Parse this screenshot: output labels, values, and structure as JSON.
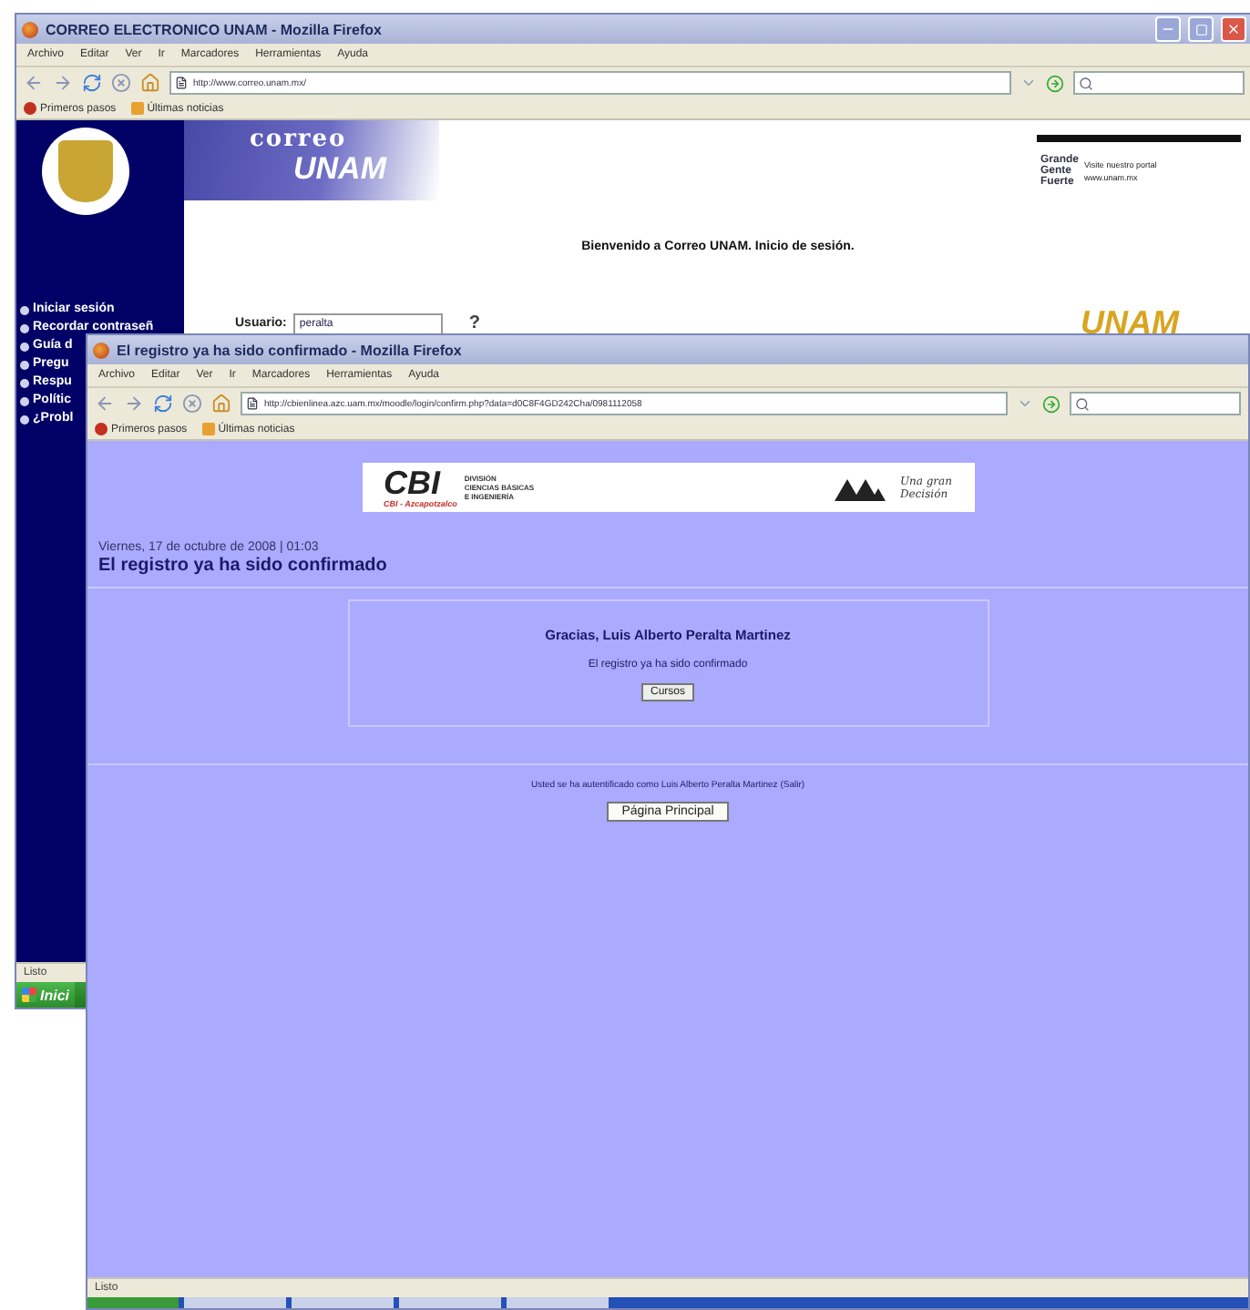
{
  "back_window": {
    "title": "CORREO ELECTRONICO UNAM - Mozilla Firefox",
    "menu": [
      "Archivo",
      "Editar",
      "Ver",
      "Ir",
      "Marcadores",
      "Herramientas",
      "Ayuda"
    ],
    "address": "http://www.correo.unam.mx/",
    "bookmarks": [
      "Primeros pasos",
      "Últimas noticias"
    ],
    "logo": {
      "line1": "correo",
      "line2": "UNAM"
    },
    "banner": {
      "words": [
        "Grande",
        "Gente",
        "Fuerte"
      ],
      "caption": "Visite nuestro portal",
      "url": "www.unam.mx"
    },
    "welcome": "Bienvenido a Correo UNAM. Inicio de sesión.",
    "sidebar": [
      {
        "label": "Iniciar sesión"
      },
      {
        "label": "Recordar contraseñ"
      },
      {
        "label": "Guía d"
      },
      {
        "label": "Pregu"
      },
      {
        "label": "Respu"
      },
      {
        "label": "Polític"
      },
      {
        "label": "¿Probl"
      }
    ],
    "login": {
      "label": "Usuario:",
      "value": "peralta",
      "help": "?"
    },
    "seal": "UNAM",
    "status": "Listo",
    "start": "Inici"
  },
  "front_window": {
    "title": "El registro ya ha sido confirmado - Mozilla Firefox",
    "menu": [
      "Archivo",
      "Editar",
      "Ver",
      "Ir",
      "Marcadores",
      "Herramientas",
      "Ayuda"
    ],
    "address": "http://cbienlinea.azc.uam.mx/moodle/login/confirm.php?data=d0C8F4GD242Cha/0981112058",
    "bookmarks": [
      "Primeros pasos",
      "Últimas noticias"
    ],
    "header": {
      "brand": "CBI",
      "division": [
        "DIVISIÓN",
        "CIENCIAS BÁSICAS",
        "E INGENIERÍA"
      ],
      "campus": "CBI - Azcapotzalco",
      "motto": [
        "Una gran",
        "Decisión"
      ]
    },
    "date": "Viernes, 17 de octubre de 2008 | 01:03",
    "heading": "El registro ya ha sido confirmado",
    "box": {
      "title": "Gracias, Luis Alberto Peralta Martinez",
      "message": "El registro ya ha sido confirmado",
      "button": "Cursos"
    },
    "footer": {
      "text": "Usted se ha autentificado como ",
      "user": "Luis Alberto Peralta Martinez",
      "logout": "(Salir)",
      "button": "Página Principal"
    },
    "status": "Listo"
  }
}
